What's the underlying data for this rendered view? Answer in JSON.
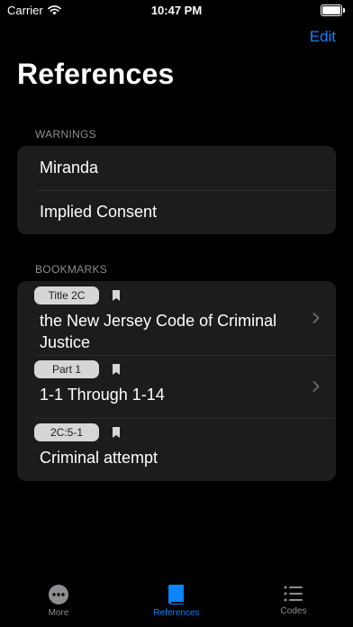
{
  "status_bar": {
    "carrier": "Carrier",
    "time": "10:47 PM"
  },
  "nav": {
    "edit_label": "Edit",
    "title": "References"
  },
  "warnings": {
    "header": "WARNINGS",
    "items": [
      {
        "label": "Miranda"
      },
      {
        "label": "Implied Consent"
      }
    ]
  },
  "bookmarks": {
    "header": "BOOKMARKS",
    "items": [
      {
        "tag": "Title 2C",
        "title": "the New Jersey Code of Criminal Justice",
        "has_chevron": true
      },
      {
        "tag": "Part 1",
        "title": "1-1 Through 1-14",
        "has_chevron": true
      },
      {
        "tag": "2C:5-1",
        "title": "Criminal attempt",
        "has_chevron": false
      }
    ]
  },
  "tabs": [
    {
      "label": "More",
      "icon": "more-icon",
      "active": false
    },
    {
      "label": "References",
      "icon": "book-icon",
      "active": true
    },
    {
      "label": "Codes",
      "icon": "list-icon",
      "active": false
    }
  ],
  "colors": {
    "accent": "#0a84ff",
    "background": "#000000",
    "card": "#1c1c1e"
  }
}
